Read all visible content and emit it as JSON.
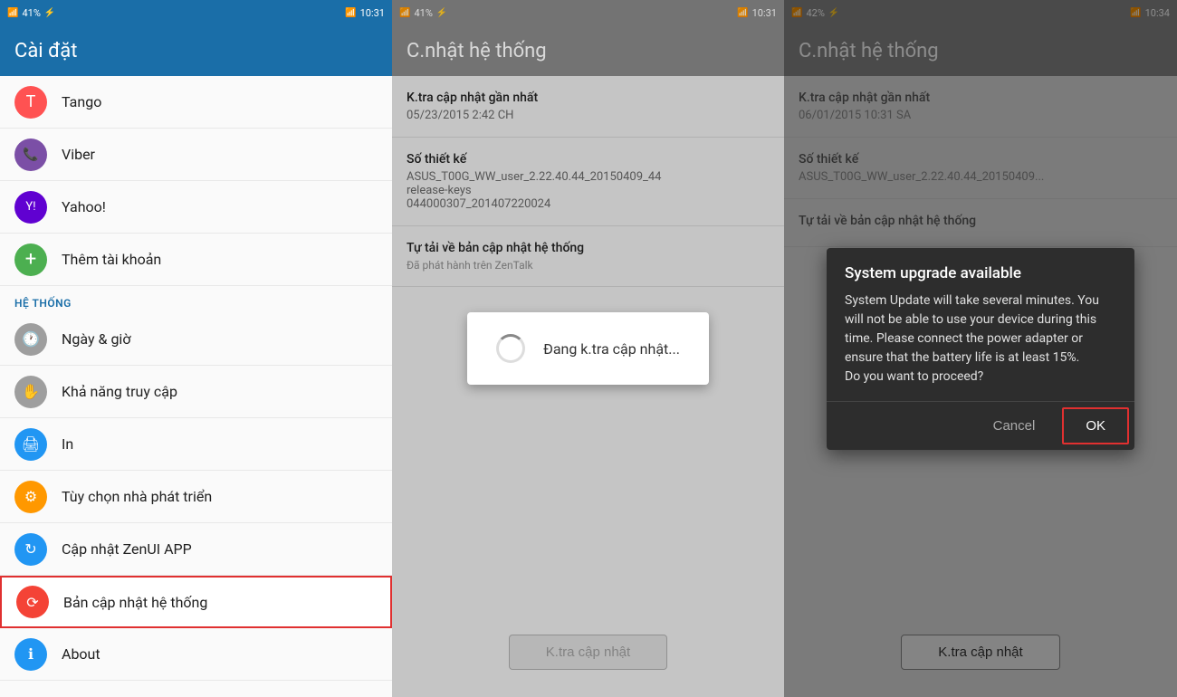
{
  "panel1": {
    "statusBar": {
      "left": "4l 41",
      "battery": "41%",
      "time": "10:31"
    },
    "title": "Cài đặt",
    "accounts": [
      {
        "id": "tango",
        "label": "Tango",
        "iconClass": "icon-tango",
        "iconSymbol": "T"
      },
      {
        "id": "viber",
        "label": "Viber",
        "iconClass": "icon-viber",
        "iconSymbol": "V"
      },
      {
        "id": "yahoo",
        "label": "Yahoo!",
        "iconClass": "icon-yahoo",
        "iconSymbol": "Y!"
      },
      {
        "id": "add-account",
        "label": "Thêm tài khoản",
        "iconClass": "icon-add",
        "iconSymbol": "+"
      }
    ],
    "sectionHeader": "HỆ THỐNG",
    "systemItems": [
      {
        "id": "datetime",
        "label": "Ngày & giờ",
        "iconClass": "icon-clock",
        "iconSymbol": "⏰"
      },
      {
        "id": "accessibility",
        "label": "Khả năng truy cập",
        "iconClass": "icon-hand",
        "iconSymbol": "✋"
      },
      {
        "id": "print",
        "label": "In",
        "iconClass": "icon-print",
        "iconSymbol": "🖨"
      },
      {
        "id": "developer",
        "label": "Tùy chọn nhà phát triển",
        "iconClass": "icon-dev",
        "iconSymbol": "⚙"
      },
      {
        "id": "zenui",
        "label": "Cập nhật ZenUI APP",
        "iconClass": "icon-update",
        "iconSymbol": "↻"
      },
      {
        "id": "system-update",
        "label": "Bản cập nhật hệ thống",
        "iconClass": "icon-system",
        "iconSymbol": "⟳",
        "highlighted": true
      },
      {
        "id": "about",
        "label": "About",
        "iconClass": "icon-info",
        "iconSymbol": "ℹ"
      }
    ]
  },
  "panel2": {
    "statusBar": {
      "time": "10:31"
    },
    "title": "C.nhật hệ thống",
    "lastCheckLabel": "K.tra cập nhật gần nhất",
    "lastCheckValue": "05/23/2015 2:42 CH",
    "buildLabel": "Số thiết kế",
    "buildValue": "ASUS_T00G_WW_user_2.22.40.44_20150409_44\nrelease-keys\n044000307_201407220024",
    "autoUpdateLabel": "Tự tải về bản cập nhật hệ thống",
    "autoUpdateValue": "Đã phát hành trên ZenTalk",
    "checkButtonLabel": "K.tra cập nhật",
    "loadingDialog": {
      "text": "Đang k.tra cập nhật..."
    }
  },
  "panel3": {
    "statusBar": {
      "time": "10:34"
    },
    "title": "C.nhật hệ thống",
    "lastCheckLabel": "K.tra cập nhật gần nhất",
    "lastCheckValue": "06/01/2015 10:31 SA",
    "buildLabel": "Số thiết kế",
    "buildValue": "ASUS_T00G_WW_user_2.22.40.44_20150409...",
    "autoUpdateLabel": "Tự tải về bản cập nhật hệ thống",
    "checkButtonLabel": "K.tra cập nhật",
    "dialog": {
      "title": "System upgrade available",
      "body": "System Update will take several minutes. You will not be able to use your device during this time. Please connect the power adapter or ensure that the battery life is at least 15%.\nDo you want to proceed?",
      "cancelLabel": "Cancel",
      "okLabel": "OK"
    }
  }
}
